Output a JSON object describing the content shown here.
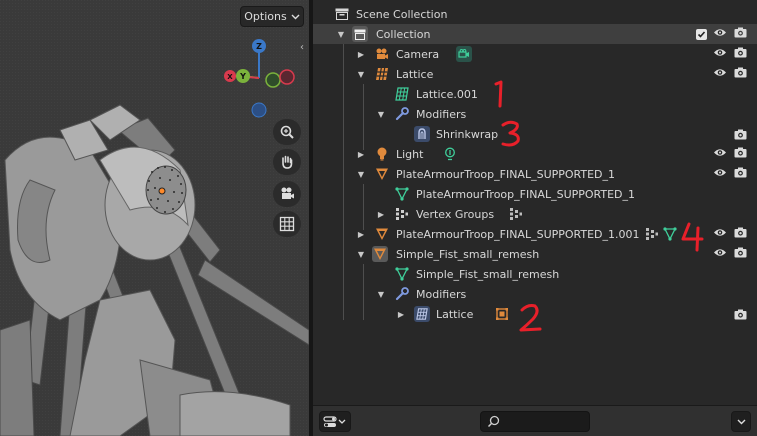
{
  "viewport": {
    "options_label": "Options",
    "gizmo": {
      "z": "Z",
      "y": "Y",
      "x": "X"
    }
  },
  "outliner": {
    "rows": [
      {
        "label": "Scene Collection",
        "icon": "scene-collection-icon"
      },
      {
        "label": "Collection",
        "icon": "collection-icon",
        "selected": true
      },
      {
        "label": "Camera",
        "icon": "camera-icon",
        "extra_icon": "camera-data-icon"
      },
      {
        "label": "Lattice",
        "icon": "lattice-icon"
      },
      {
        "label": "Lattice.001",
        "icon": "lattice-data-icon"
      },
      {
        "label": "Modifiers",
        "icon": "wrench-icon"
      },
      {
        "label": "Shrinkwrap",
        "icon": "shrinkwrap-modifier-icon"
      },
      {
        "label": "Light",
        "icon": "light-icon",
        "extra_icon": "light-data-icon"
      },
      {
        "label": "PlateArmourTroop_FINAL_SUPPORTED_1",
        "icon": "mesh-object-icon"
      },
      {
        "label": "PlateArmourTroop_FINAL_SUPPORTED_1",
        "icon": "mesh-data-icon"
      },
      {
        "label": "Vertex Groups",
        "icon": "vertex-groups-icon",
        "extra_icon": "vertex-groups-icon"
      },
      {
        "label": "PlateArmourTroop_FINAL_SUPPORTED_1.001",
        "icon": "mesh-object-icon",
        "extra_icons": [
          "vertex-groups-icon",
          "mesh-data-icon"
        ]
      },
      {
        "label": "Simple_Fist_small_remesh",
        "icon": "mesh-object-icon"
      },
      {
        "label": "Simple_Fist_small_remesh",
        "icon": "mesh-data-icon"
      },
      {
        "label": "Modifiers",
        "icon": "wrench-icon"
      },
      {
        "label": "Lattice",
        "icon": "lattice-modifier-icon",
        "extra_icon": "lattice-object-icon"
      }
    ]
  },
  "annotations": [
    "1",
    "3",
    "4",
    "2"
  ],
  "colors": {
    "outliner_bg": "#282828",
    "selected_row": "#3f3f3f",
    "object_orange": "#e08a3c",
    "data_green": "#3fcf9b",
    "modifier_blue": "#7f9ae0",
    "annotation_red": "#e8202a"
  }
}
